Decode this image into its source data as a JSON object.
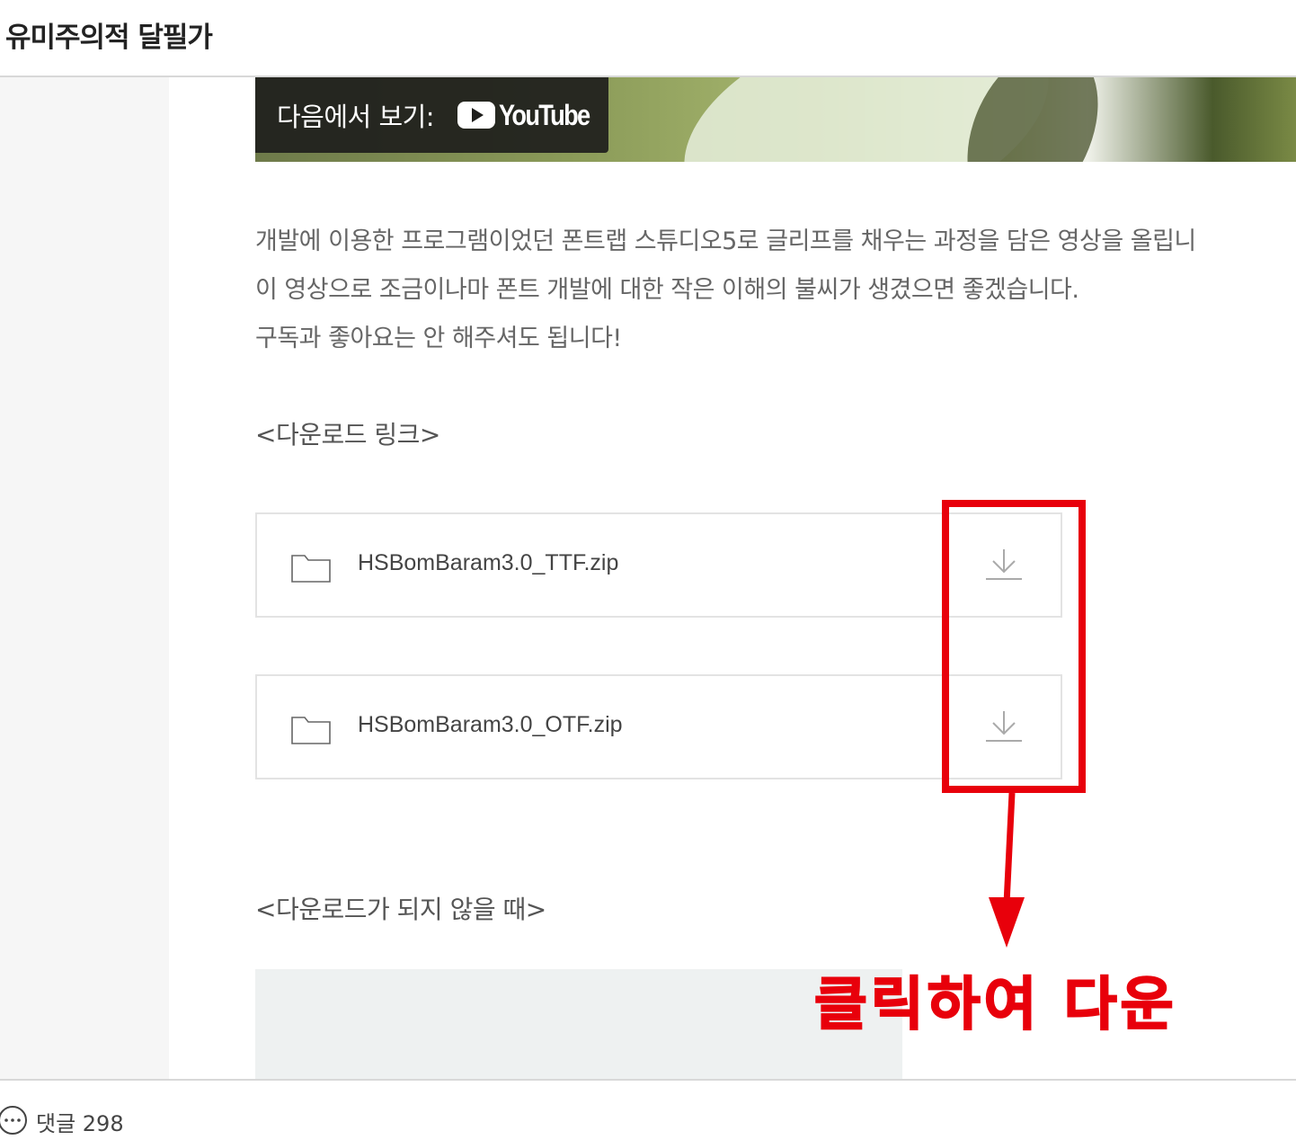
{
  "header": {
    "site_title": "유미주의적 달필가"
  },
  "video": {
    "watch_on_label": "다음에서 보기:",
    "platform": "YouTube",
    "icon": "youtube-play-icon"
  },
  "body": {
    "paragraphs": [
      "개발에 이용한 프로그램이었던 폰트랩 스튜디오5로 글리프를 채우는 과정을 담은 영상을 올립니",
      "이 영상으로 조금이나마 폰트 개발에 대한 작은 이해의 불씨가 생겼으면 좋겠습니다.",
      "구독과 좋아요는 안 해주셔도 됩니다!"
    ],
    "download_heading": "<다운로드 링크>",
    "failed_heading": "<다운로드가 되지 않을 때>"
  },
  "files": [
    {
      "name": "HSBomBaram3.0_TTF.zip",
      "icon": "folder-icon",
      "action_icon": "download-icon"
    },
    {
      "name": "HSBomBaram3.0_OTF.zip",
      "icon": "folder-icon",
      "action_icon": "download-icon"
    }
  ],
  "annotation": {
    "callout_text": "클릭하여 다운",
    "color": "#e8000b"
  },
  "footer": {
    "comment_label": "댓글 298",
    "icon": "comment-bubble-icon"
  },
  "colors": {
    "accent_red": "#e8000b",
    "sidebar_bg": "#f6f6f6",
    "text_gray": "#666666"
  }
}
